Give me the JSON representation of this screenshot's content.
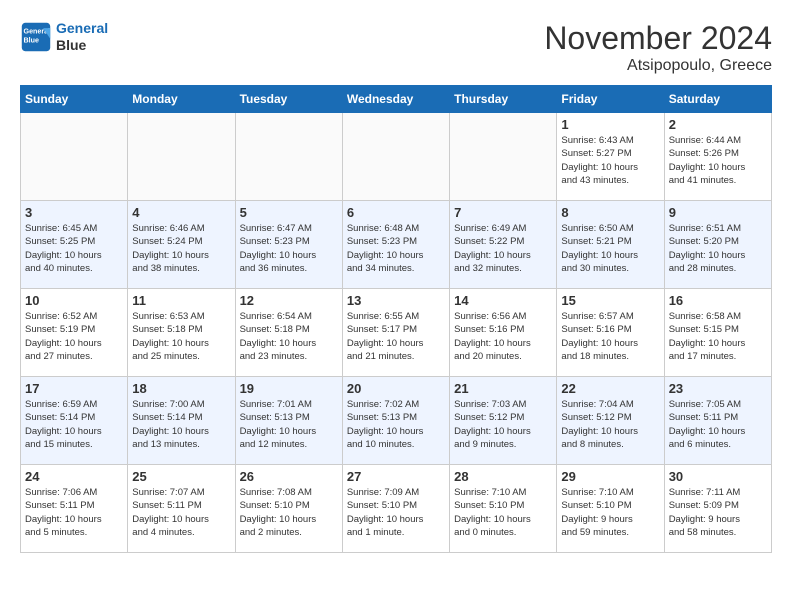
{
  "header": {
    "logo_line1": "General",
    "logo_line2": "Blue",
    "month": "November 2024",
    "location": "Atsipopoulo, Greece"
  },
  "weekdays": [
    "Sunday",
    "Monday",
    "Tuesday",
    "Wednesday",
    "Thursday",
    "Friday",
    "Saturday"
  ],
  "weeks": [
    [
      {
        "day": "",
        "info": ""
      },
      {
        "day": "",
        "info": ""
      },
      {
        "day": "",
        "info": ""
      },
      {
        "day": "",
        "info": ""
      },
      {
        "day": "",
        "info": ""
      },
      {
        "day": "1",
        "info": "Sunrise: 6:43 AM\nSunset: 5:27 PM\nDaylight: 10 hours\nand 43 minutes."
      },
      {
        "day": "2",
        "info": "Sunrise: 6:44 AM\nSunset: 5:26 PM\nDaylight: 10 hours\nand 41 minutes."
      }
    ],
    [
      {
        "day": "3",
        "info": "Sunrise: 6:45 AM\nSunset: 5:25 PM\nDaylight: 10 hours\nand 40 minutes."
      },
      {
        "day": "4",
        "info": "Sunrise: 6:46 AM\nSunset: 5:24 PM\nDaylight: 10 hours\nand 38 minutes."
      },
      {
        "day": "5",
        "info": "Sunrise: 6:47 AM\nSunset: 5:23 PM\nDaylight: 10 hours\nand 36 minutes."
      },
      {
        "day": "6",
        "info": "Sunrise: 6:48 AM\nSunset: 5:23 PM\nDaylight: 10 hours\nand 34 minutes."
      },
      {
        "day": "7",
        "info": "Sunrise: 6:49 AM\nSunset: 5:22 PM\nDaylight: 10 hours\nand 32 minutes."
      },
      {
        "day": "8",
        "info": "Sunrise: 6:50 AM\nSunset: 5:21 PM\nDaylight: 10 hours\nand 30 minutes."
      },
      {
        "day": "9",
        "info": "Sunrise: 6:51 AM\nSunset: 5:20 PM\nDaylight: 10 hours\nand 28 minutes."
      }
    ],
    [
      {
        "day": "10",
        "info": "Sunrise: 6:52 AM\nSunset: 5:19 PM\nDaylight: 10 hours\nand 27 minutes."
      },
      {
        "day": "11",
        "info": "Sunrise: 6:53 AM\nSunset: 5:18 PM\nDaylight: 10 hours\nand 25 minutes."
      },
      {
        "day": "12",
        "info": "Sunrise: 6:54 AM\nSunset: 5:18 PM\nDaylight: 10 hours\nand 23 minutes."
      },
      {
        "day": "13",
        "info": "Sunrise: 6:55 AM\nSunset: 5:17 PM\nDaylight: 10 hours\nand 21 minutes."
      },
      {
        "day": "14",
        "info": "Sunrise: 6:56 AM\nSunset: 5:16 PM\nDaylight: 10 hours\nand 20 minutes."
      },
      {
        "day": "15",
        "info": "Sunrise: 6:57 AM\nSunset: 5:16 PM\nDaylight: 10 hours\nand 18 minutes."
      },
      {
        "day": "16",
        "info": "Sunrise: 6:58 AM\nSunset: 5:15 PM\nDaylight: 10 hours\nand 17 minutes."
      }
    ],
    [
      {
        "day": "17",
        "info": "Sunrise: 6:59 AM\nSunset: 5:14 PM\nDaylight: 10 hours\nand 15 minutes."
      },
      {
        "day": "18",
        "info": "Sunrise: 7:00 AM\nSunset: 5:14 PM\nDaylight: 10 hours\nand 13 minutes."
      },
      {
        "day": "19",
        "info": "Sunrise: 7:01 AM\nSunset: 5:13 PM\nDaylight: 10 hours\nand 12 minutes."
      },
      {
        "day": "20",
        "info": "Sunrise: 7:02 AM\nSunset: 5:13 PM\nDaylight: 10 hours\nand 10 minutes."
      },
      {
        "day": "21",
        "info": "Sunrise: 7:03 AM\nSunset: 5:12 PM\nDaylight: 10 hours\nand 9 minutes."
      },
      {
        "day": "22",
        "info": "Sunrise: 7:04 AM\nSunset: 5:12 PM\nDaylight: 10 hours\nand 8 minutes."
      },
      {
        "day": "23",
        "info": "Sunrise: 7:05 AM\nSunset: 5:11 PM\nDaylight: 10 hours\nand 6 minutes."
      }
    ],
    [
      {
        "day": "24",
        "info": "Sunrise: 7:06 AM\nSunset: 5:11 PM\nDaylight: 10 hours\nand 5 minutes."
      },
      {
        "day": "25",
        "info": "Sunrise: 7:07 AM\nSunset: 5:11 PM\nDaylight: 10 hours\nand 4 minutes."
      },
      {
        "day": "26",
        "info": "Sunrise: 7:08 AM\nSunset: 5:10 PM\nDaylight: 10 hours\nand 2 minutes."
      },
      {
        "day": "27",
        "info": "Sunrise: 7:09 AM\nSunset: 5:10 PM\nDaylight: 10 hours\nand 1 minute."
      },
      {
        "day": "28",
        "info": "Sunrise: 7:10 AM\nSunset: 5:10 PM\nDaylight: 10 hours\nand 0 minutes."
      },
      {
        "day": "29",
        "info": "Sunrise: 7:10 AM\nSunset: 5:10 PM\nDaylight: 9 hours\nand 59 minutes."
      },
      {
        "day": "30",
        "info": "Sunrise: 7:11 AM\nSunset: 5:09 PM\nDaylight: 9 hours\nand 58 minutes."
      }
    ]
  ]
}
